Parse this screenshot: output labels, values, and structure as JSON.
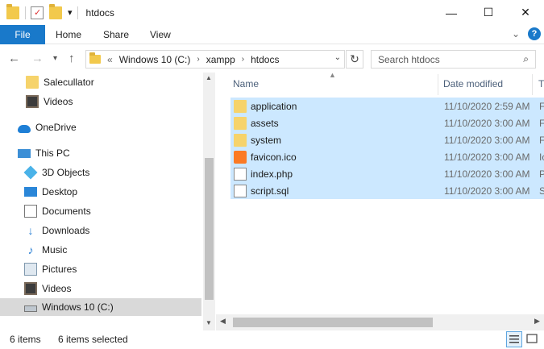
{
  "titlebar": {
    "title": "htdocs",
    "minimize": "—",
    "maximize": "☐",
    "close": "✕",
    "qa_dropdown": "▾"
  },
  "ribbon": {
    "tabs": [
      "File",
      "Home",
      "Share",
      "View"
    ],
    "collapse": "⌄",
    "help": "?"
  },
  "address": {
    "back": "←",
    "forward": "→",
    "recent": "▾",
    "up": "↑",
    "overflow": "«",
    "crumbs": [
      "Windows 10 (C:)",
      "xampp",
      "htdocs"
    ],
    "separator": "›",
    "dropdown": "⌄",
    "refresh": "↻",
    "search_placeholder": "Search htdocs",
    "search_icon": "⌕"
  },
  "nav": {
    "items": [
      {
        "label": "Salecullator",
        "icon": "folder-icon"
      },
      {
        "label": "Videos",
        "icon": "videos-icon"
      },
      {
        "label": "OneDrive",
        "icon": "onedrive-icon"
      },
      {
        "label": "This PC",
        "icon": "this-pc-icon"
      },
      {
        "label": "3D Objects",
        "icon": "3d-objects-icon"
      },
      {
        "label": "Desktop",
        "icon": "desktop-icon"
      },
      {
        "label": "Documents",
        "icon": "documents-icon"
      },
      {
        "label": "Downloads",
        "icon": "downloads-icon"
      },
      {
        "label": "Music",
        "icon": "music-icon"
      },
      {
        "label": "Pictures",
        "icon": "pictures-icon"
      },
      {
        "label": "Videos",
        "icon": "videos-icon"
      },
      {
        "label": "Windows 10 (C:)",
        "icon": "drive-icon"
      }
    ],
    "selected": "Windows 10 (C:)"
  },
  "columns": {
    "name": "Name",
    "date": "Date modified",
    "type": "T"
  },
  "files": [
    {
      "name": "application",
      "date": "11/10/2020 2:59 AM",
      "type": "F",
      "icon": "folder-icon"
    },
    {
      "name": "assets",
      "date": "11/10/2020 3:00 AM",
      "type": "F",
      "icon": "folder-icon"
    },
    {
      "name": "system",
      "date": "11/10/2020 3:00 AM",
      "type": "F",
      "icon": "folder-icon"
    },
    {
      "name": "favicon.ico",
      "date": "11/10/2020 3:00 AM",
      "type": "Ic",
      "icon": "xampp-icon"
    },
    {
      "name": "index.php",
      "date": "11/10/2020 3:00 AM",
      "type": "P",
      "icon": "file-icon"
    },
    {
      "name": "script.sql",
      "date": "11/10/2020 3:00 AM",
      "type": "S",
      "icon": "file-icon"
    }
  ],
  "status": {
    "count": "6 items",
    "selected": "6 items selected"
  },
  "colors": {
    "accent": "#1979ca",
    "selection": "#cce8ff"
  }
}
